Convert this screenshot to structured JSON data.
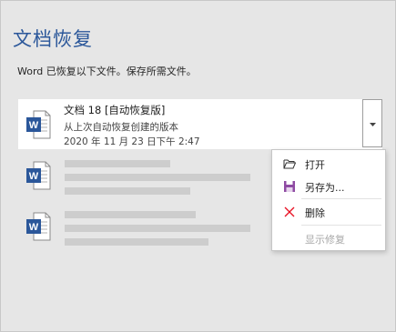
{
  "page": {
    "title": "文档恢复",
    "description": "Word 已恢复以下文件。保存所需文件。"
  },
  "files": [
    {
      "name": "文档 18 [自动恢复版]",
      "subtitle": "从上次自动恢复创建的版本",
      "date": "2020 年 11 月 23 日下午 2:47",
      "icon": "word-document-icon"
    }
  ],
  "context_menu": {
    "items": [
      {
        "label": "打开",
        "icon": "open-folder-icon",
        "enabled": true
      },
      {
        "label": "另存为...",
        "icon": "save-icon",
        "enabled": true
      },
      {
        "label": "删除",
        "icon": "delete-x-icon",
        "enabled": true
      },
      {
        "label": "显示修复",
        "icon": "",
        "enabled": false
      }
    ]
  },
  "colors": {
    "accent": "#2b579a",
    "word_blue": "#2b579a",
    "delete_red": "#e81123",
    "save_purple": "#8f4ba3"
  }
}
